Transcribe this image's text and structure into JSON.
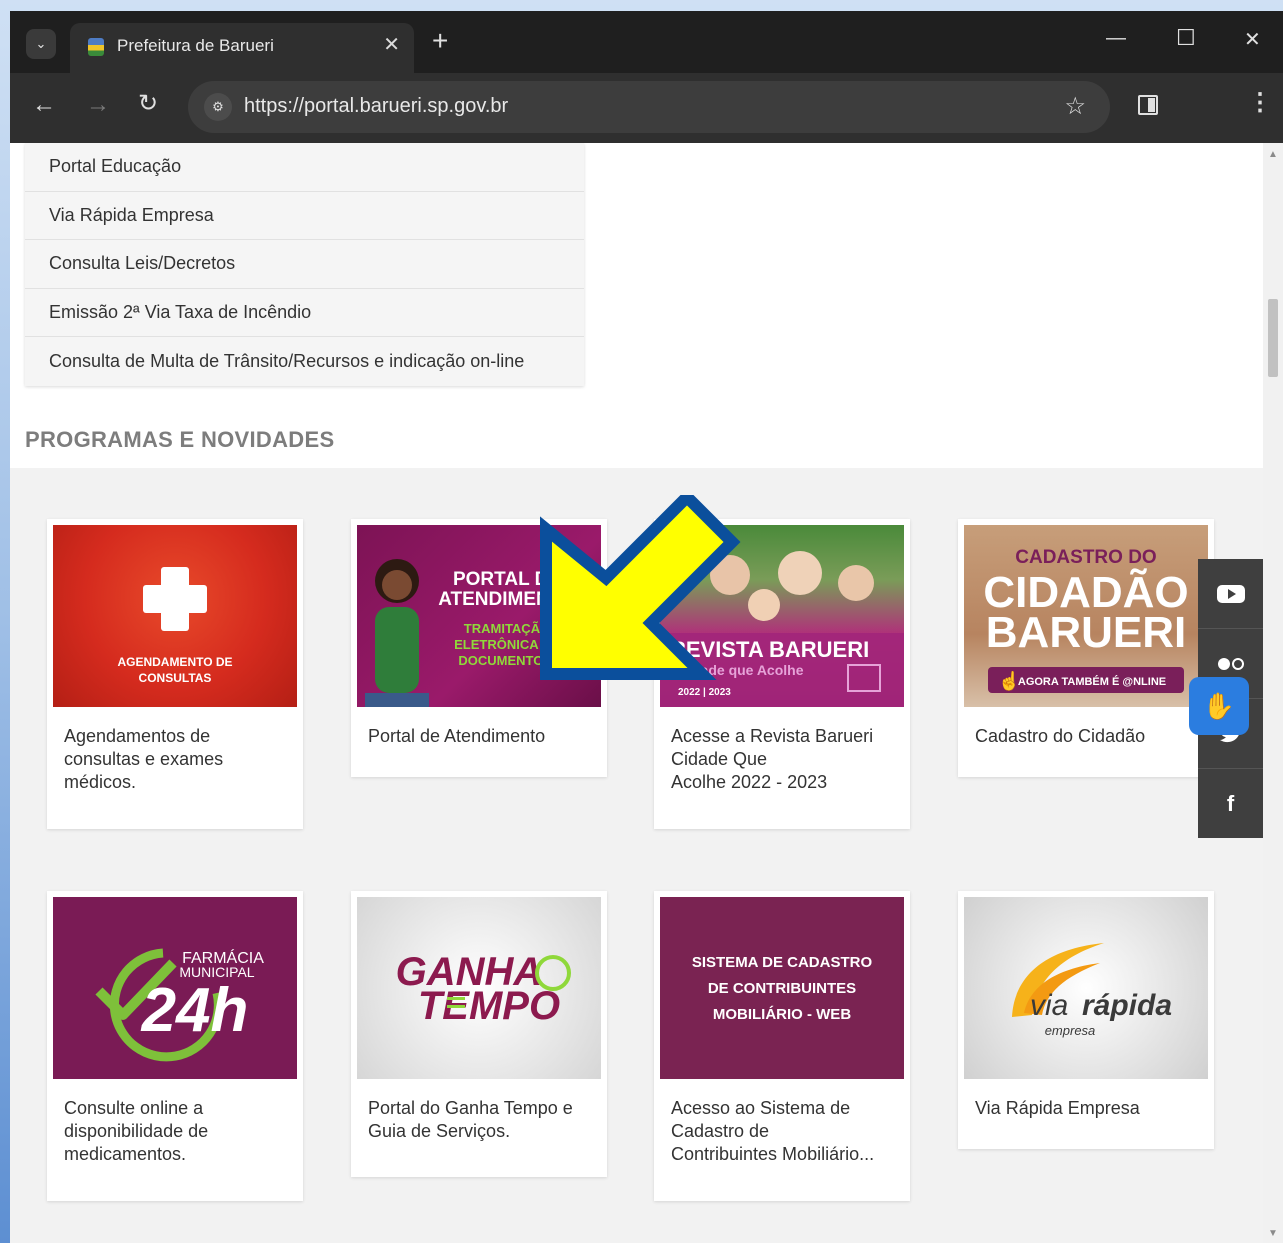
{
  "browser": {
    "tab_title": "Prefeitura de Barueri",
    "url": "https://portal.barueri.sp.gov.br"
  },
  "links": [
    "Portal Educação",
    "Via Rápida Empresa",
    "Consulta Leis/Decretos",
    "Emissão 2ª Via Taxa de Incêndio",
    "Consulta de Multa de Trânsito/Recursos e indicação on-line"
  ],
  "section_title": "PROGRAMAS E NOVIDADES",
  "cards": [
    {
      "caption": "Agendamentos de consultas e exames médicos.",
      "banner": [
        "AGENDAMENTO DE",
        "CONSULTAS"
      ]
    },
    {
      "caption": "Portal de Atendimento",
      "banner": [
        "PORTAL DE",
        "ATENDIMENTO",
        "TRAMITAÇÃO",
        "ELETRÔNICA DE",
        "DOCUMENTOS."
      ]
    },
    {
      "caption_lines": [
        "Acesse a Revista Barueri",
        "Cidade Que",
        "Acolhe 2022 - 2023"
      ],
      "banner": [
        "REVISTA BARUERI",
        "Cidade que Acolhe",
        "2022 | 2023"
      ]
    },
    {
      "caption": "Cadastro do Cidadão",
      "banner": [
        "CADASTRO DO",
        "CIDADÃO",
        "BARUERI",
        "AGORA TAMBÉM É @NLINE"
      ]
    },
    {
      "caption": "Consulte online a disponibilidade de medicamentos.",
      "banner": [
        "FARMÁCIA",
        "MUNICIPAL",
        "24h"
      ]
    },
    {
      "caption": "Portal do Ganha Tempo e Guia de Serviços.",
      "banner": [
        "GANHA",
        "TEMPO"
      ]
    },
    {
      "caption_lines": [
        "Acesso ao Sistema de",
        "Cadastro de",
        "Contribuintes Mobiliário..."
      ],
      "banner": [
        "SISTEMA DE CADASTRO",
        "DE CONTRIBUINTES",
        "MOBILIÁRIO - WEB"
      ]
    },
    {
      "caption": "Via Rápida Empresa",
      "banner": [
        "via",
        "rápida",
        "empresa"
      ]
    }
  ],
  "social": [
    "youtube-icon",
    "flickr-icon",
    "twitter-icon",
    "facebook-icon"
  ],
  "social_glyphs": {
    "facebook": "f"
  },
  "colors": {
    "arrow_fill": "#ffff00",
    "arrow_stroke": "#0b4f9c",
    "section_title": "#7d7d7d",
    "libras_button": "#2b7de0"
  }
}
